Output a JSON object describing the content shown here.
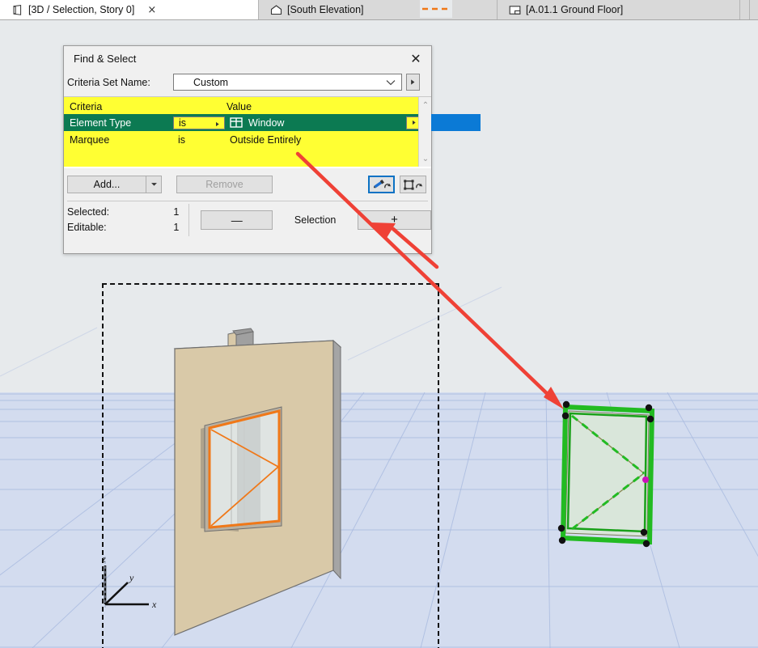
{
  "tabs": [
    {
      "label": "[3D / Selection, Story 0]",
      "icon": "cube-icon",
      "active": true,
      "closable": true,
      "close_label": "×"
    },
    {
      "label": "[South Elevation]",
      "icon": "elevation-house-icon",
      "active": false,
      "closable": false
    },
    {
      "label": "[A.01.1 Ground Floor]",
      "icon": "floorplan-icon",
      "active": false,
      "closable": false
    }
  ],
  "dialog": {
    "title": "Find & Select",
    "close_label": "✕",
    "criteria_set": {
      "label": "Criteria Set Name:",
      "value": "Custom",
      "chevron": "chevron-down-icon",
      "side_button": "play-triangle-icon"
    },
    "table": {
      "headers": {
        "criteria": "Criteria",
        "value": "Value"
      },
      "rows": [
        {
          "name": "Element Type",
          "operator": "is",
          "value": "Window",
          "value_icon": "window-grid-icon",
          "selected": true
        },
        {
          "name": "Marquee",
          "operator": "is",
          "value": "Outside Entirely",
          "value_icon": "",
          "selected": false
        }
      ],
      "scroll_up": "⌃",
      "scroll_down": "⌄"
    },
    "buttons": {
      "add": "Add...",
      "add_dropdown": "chevron-down-icon",
      "remove": "Remove",
      "eyedropper_tool": "eyedropper-pickup-icon",
      "marquee_tool": "marquee-inject-icon"
    },
    "footer": {
      "selected_label": "Selected:",
      "selected_count": "1",
      "editable_label": "Editable:",
      "editable_count": "1",
      "minus_label": "—",
      "selection_label": "Selection",
      "plus_label": "+"
    }
  },
  "canvas": {
    "axis": {
      "x": "x",
      "y": "y",
      "z": "z"
    },
    "marquee_style": "dashed-rectangle",
    "selected_element": "window-green-highlight",
    "wall_element": "wall-with-orange-window"
  },
  "annotations": [
    {
      "name": "arrow-criteria-to-canvas",
      "color": "#ef4136"
    },
    {
      "name": "arrow-to-plus-button",
      "color": "#ef4136"
    }
  ],
  "colors": {
    "accent_blue": "#0b7ad6",
    "row_green": "#0c7a52",
    "highlight_yellow": "#ffff33",
    "annotation_red": "#ef4136",
    "selection_green": "#22bb22",
    "window_orange": "#f07818",
    "wall_beige": "#d9c9a8",
    "ground": "#d3dcef",
    "sky": "#e7eaec"
  }
}
